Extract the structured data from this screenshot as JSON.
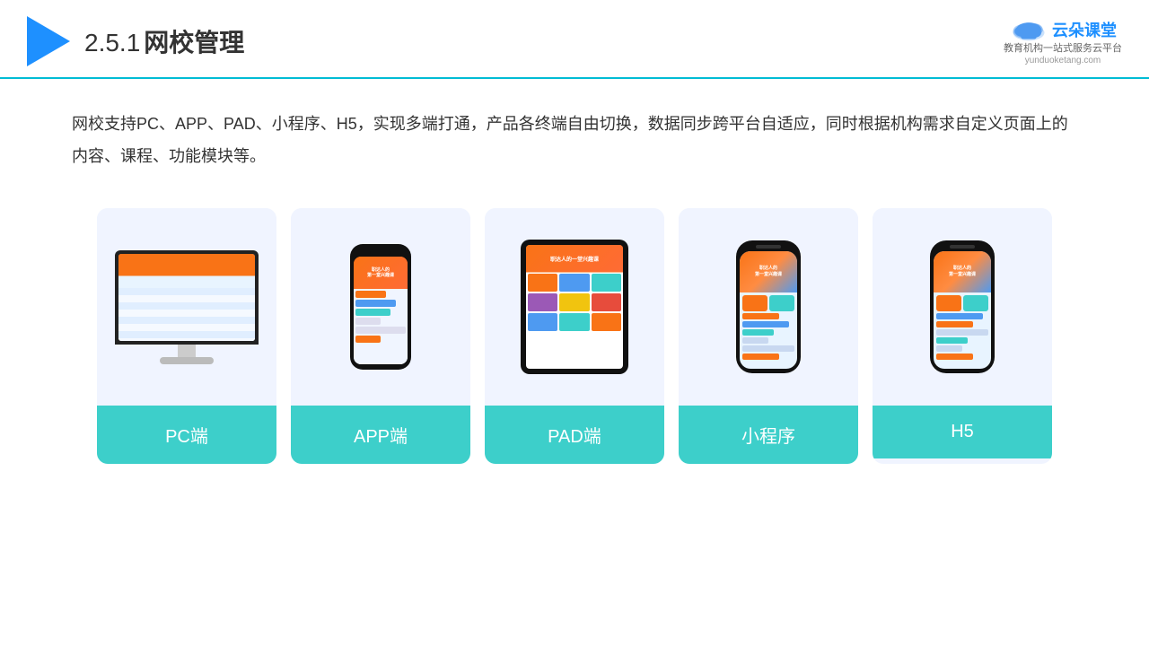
{
  "header": {
    "title": "2.5.1网校管理",
    "title_number": "2.5.1",
    "title_text": "网校管理",
    "brand_name": "云朵课堂",
    "brand_url": "yunduoketang.com",
    "brand_tagline_line1": "教育机构一站",
    "brand_tagline_line2": "式服务云平台"
  },
  "description": {
    "text": "网校支持PC、APP、PAD、小程序、H5，实现多端打通，产品各终端自由切换，数据同步跨平台自适应，同时根据机构需求自定义页面上的内容、课程、功能模块等。"
  },
  "cards": [
    {
      "id": "pc",
      "label": "PC端",
      "type": "monitor"
    },
    {
      "id": "app",
      "label": "APP端",
      "type": "phone"
    },
    {
      "id": "pad",
      "label": "PAD端",
      "type": "tablet"
    },
    {
      "id": "miniprogram",
      "label": "小程序",
      "type": "phone-modern"
    },
    {
      "id": "h5",
      "label": "H5",
      "type": "phone-modern"
    }
  ],
  "colors": {
    "accent": "#3dcfca",
    "blue": "#1e90ff",
    "header_border": "#00bcd4",
    "orange": "#f97316"
  }
}
